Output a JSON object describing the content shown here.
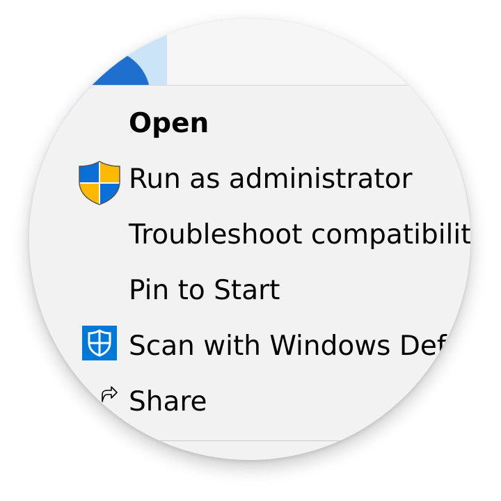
{
  "menu": {
    "items": [
      {
        "label": "Open",
        "icon": null,
        "bold": true
      },
      {
        "label": "Run as administrator",
        "icon": "uac-shield-icon",
        "bold": false
      },
      {
        "label": "Troubleshoot compatibility",
        "icon": null,
        "bold": false
      },
      {
        "label": "Pin to Start",
        "icon": null,
        "bold": false
      },
      {
        "label": "Scan with Windows Defe",
        "icon": "windows-defender-icon",
        "bold": false
      },
      {
        "label": "Share",
        "icon": "share-icon",
        "bold": false
      }
    ]
  },
  "colors": {
    "menu_background": "#f2f2f2",
    "accent_blue": "#1f6fcf",
    "light_blue": "#cce4f7",
    "shield_yellow": "#ffb900",
    "shield_blue": "#0a6fd6",
    "defender_blue": "#0078d7"
  }
}
